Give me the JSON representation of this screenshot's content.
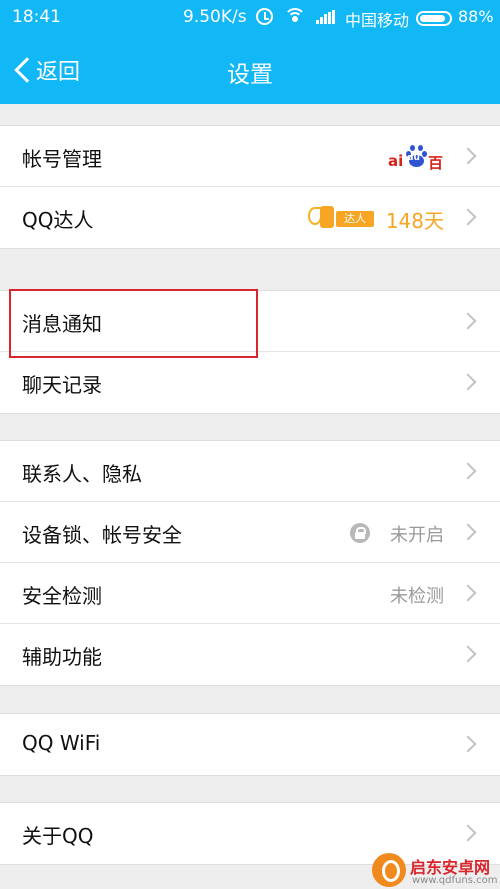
{
  "status_bar": {
    "time": "18:41",
    "speed": "9.50K/s",
    "carrier": "中国移动",
    "battery": "88%",
    "battery_level": 0.88,
    "icons": [
      "alarm-icon",
      "wifi-icon",
      "signal-icon",
      "battery-icon"
    ]
  },
  "nav": {
    "back_label": "返回",
    "title": "设置"
  },
  "groups": [
    {
      "rows": [
        {
          "label": "帐号管理",
          "badge": "baidu-logo"
        },
        {
          "label": "QQ达人",
          "badge": "qq-talent",
          "value": "148天"
        }
      ]
    },
    {
      "rows": [
        {
          "label": "消息通知",
          "highlighted": true
        },
        {
          "label": "聊天记录"
        }
      ]
    },
    {
      "rows": [
        {
          "label": "联系人、隐私"
        },
        {
          "label": "设备锁、帐号安全",
          "value": "未开启",
          "icon": "lock-icon"
        },
        {
          "label": "安全检测",
          "value": "未检测"
        },
        {
          "label": "辅助功能"
        }
      ]
    },
    {
      "rows": [
        {
          "label": "QQ WiFi"
        }
      ]
    },
    {
      "rows": [
        {
          "label": "关于QQ"
        }
      ]
    }
  ],
  "badges": {
    "baidu_text_left": "ai",
    "baidu_text_paw": "du",
    "baidu_text_right": "百",
    "talent_text": "达人"
  },
  "watermark": {
    "title": "启东安卓网",
    "url": "www.qdfuns.com"
  },
  "colors": {
    "accent": "#12b7f5",
    "highlight": "#d9262c",
    "value_orange": "#f6a623"
  }
}
